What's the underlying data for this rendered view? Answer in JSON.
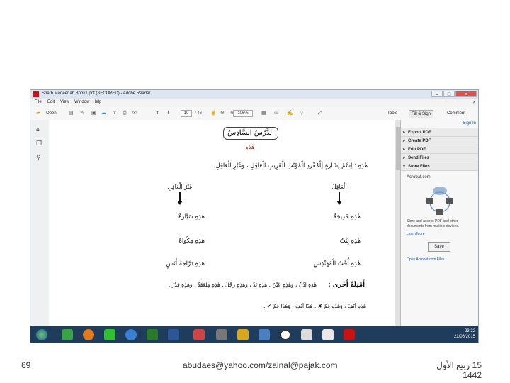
{
  "window": {
    "title": "Sharh Madeenah Book1.pdf (SECURED) - Adobe Reader",
    "controls": [
      "–",
      "□",
      "✕"
    ]
  },
  "menu": [
    "File",
    "Edit",
    "View",
    "Window",
    "Help"
  ],
  "toolbar": {
    "open": "Open",
    "page_current": "10",
    "page_total": "/ 46",
    "zoom": "106%",
    "tools": "Tools",
    "fill_sign": "Fill & Sign",
    "comment": "Comment"
  },
  "right_pane": {
    "sign_in": "Sign In",
    "items": [
      "Export PDF",
      "Create PDF",
      "Edit PDF",
      "Send Files",
      "Store Files"
    ],
    "acrobat_com": "Acrobat.com",
    "store_desc": "Store and access PDF and other documents from multiple devices.",
    "learn_more": "Learn More",
    "save": "Save",
    "open_link": "Open Acrobat.com Files"
  },
  "document": {
    "lesson_title": "الدَّرْسُ السَّادِسُ",
    "word": "هٰذِهِ",
    "intro": "هٰذِهِ : اِسْمُ إِشَارَةٍ لِلْمُفْرَدِ الْمُؤَنَّثِ الْقَرِيبِ الْعَاقِلِ ، وَغَيْرِ الْعَاقِلِ .",
    "right_col_header": "الْعَاقِلُ",
    "left_col_header": "غَيْرُ الْعَاقِلِ",
    "right_col": [
      "هٰذِهِ خَدِيجَةُ",
      "هٰذِهِ بِنْتٌ",
      "هٰذِهِ أُخْتُ الْمُهَنْدِسِ"
    ],
    "left_col": [
      "هٰذِهِ سَيَّارَةٌ",
      "هٰذِهِ مِكْوَاةٌ",
      "هٰذِهِ دَرَّاجَةُ أَنَسٍ"
    ],
    "more_examples_label": "أَمْثِلَةٌ أُخْرَى :",
    "more_examples": "هٰذِهِ أُذُنٌ ، وَهٰذِهِ عَيْنٌ .     هٰذِهِ يَدٌ ، وَهٰذِهِ رِجْلٌ .     هٰذِهِ مِلْعَقَةٌ ، وَهٰذِهِ قِدْرٌ .",
    "last_line": "هٰذِهِ أَنْفٌ ، وَهٰذِهِ فَمٌ ✘ .     هٰذَا أَنْفٌ ، وَهٰذَا فَمٌ ✔ ."
  },
  "taskbar": {
    "time": "23:32",
    "date": "21/08/2015"
  },
  "slide_footer": {
    "page_number": "69",
    "email": "abudaes@yahoo.com/zainal@pajak.com",
    "date": "15 ربيع الأول 1442"
  },
  "colors": {
    "taskbar": "#1f3c5c",
    "accent_red": "#cc1111",
    "link_blue": "#1a56a8"
  }
}
